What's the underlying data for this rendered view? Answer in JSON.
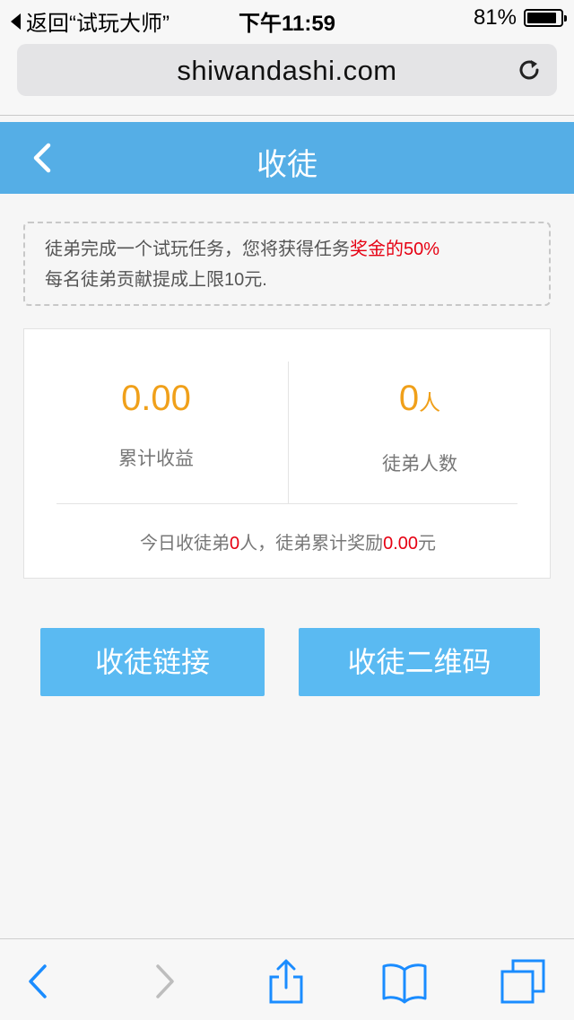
{
  "status_bar": {
    "back_label": "返回“试玩大师”",
    "time": "下午11:59",
    "battery": "81%",
    "battery_level": 0.81
  },
  "browser": {
    "url": "shiwandashi.com"
  },
  "header": {
    "title": "收徒"
  },
  "notice": {
    "line1_prefix": "徒弟完成一个试玩任务，您将获得任务",
    "line1_highlight": "奖金的50%",
    "line2": "每名徒弟贡献提成上限10元."
  },
  "stats": {
    "earnings_value": "0.00",
    "earnings_label": "累计收益",
    "apprentice_count": "0",
    "apprentice_unit": "人",
    "apprentice_label": "徒弟人数",
    "summary_part1": "今日收徒弟",
    "summary_today_count": "0",
    "summary_part2": "人，徒弟累计奖励",
    "summary_reward": "0.00",
    "summary_part3": "元"
  },
  "actions": {
    "link_button": "收徒链接",
    "qr_button": "收徒二维码"
  },
  "colors": {
    "header_bg": "#55aee6",
    "button_bg": "#5abaf2",
    "accent_orange": "#f0a01a",
    "highlight_red": "#e60012"
  },
  "icons": {
    "back": "chevron-left-icon",
    "reload": "reload-icon",
    "toolbar": [
      "back-icon",
      "forward-icon",
      "share-icon",
      "bookmarks-icon",
      "tabs-icon"
    ]
  }
}
